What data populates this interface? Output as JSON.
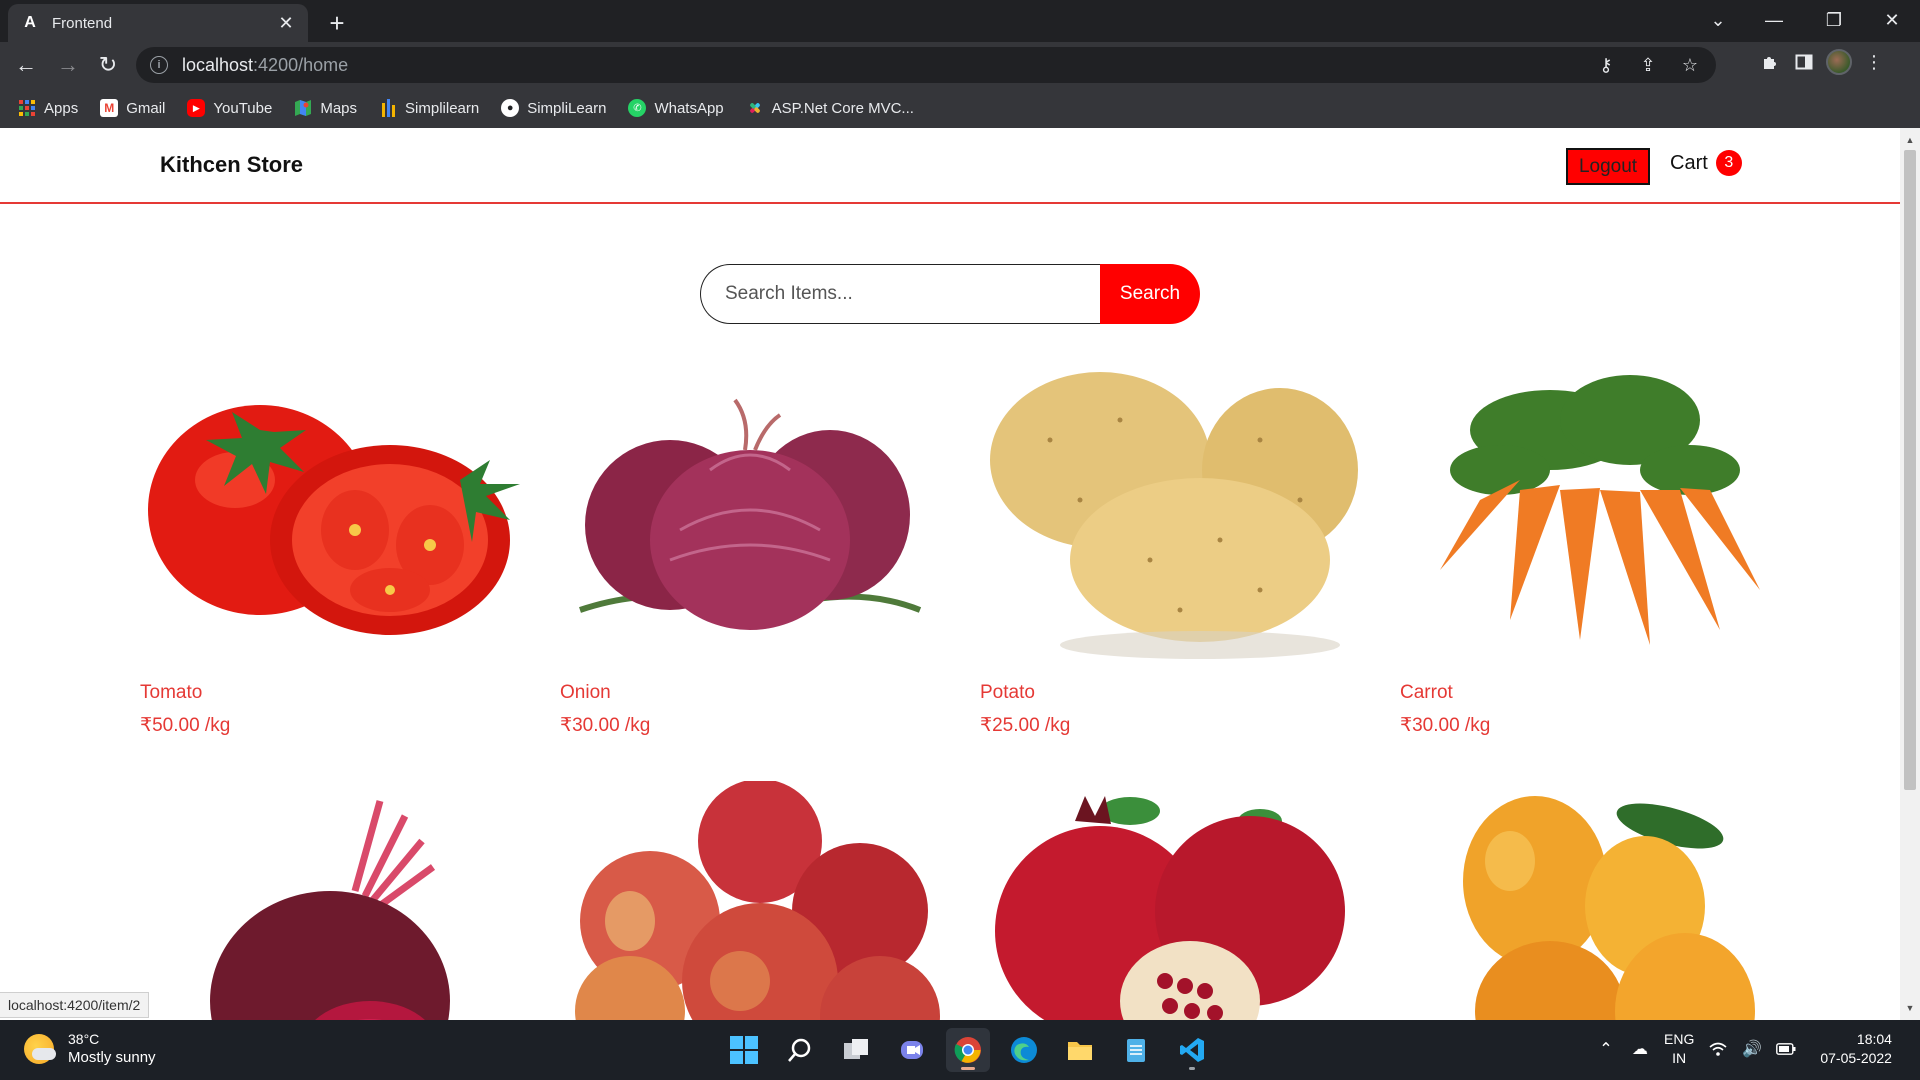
{
  "browser": {
    "tab_title": "Frontend",
    "tab_favicon": "A",
    "url_host": "localhost",
    "url_path": ":4200/home",
    "bookmarks": [
      {
        "label": "Apps",
        "icon": "apps-grid-icon",
        "color": "#4285f4"
      },
      {
        "label": "Gmail",
        "icon": "gmail-icon",
        "color": "#ea4335"
      },
      {
        "label": "YouTube",
        "icon": "youtube-icon",
        "color": "#ff0000"
      },
      {
        "label": "Maps",
        "icon": "maps-icon",
        "color": "#34a853"
      },
      {
        "label": "Simplilearn",
        "icon": "simplilearn-icon",
        "color": "#f4b400"
      },
      {
        "label": "SimpliLearn",
        "icon": "github-icon",
        "color": "#ffffff"
      },
      {
        "label": "WhatsApp",
        "icon": "whatsapp-icon",
        "color": "#25d366"
      },
      {
        "label": "ASP.Net Core MVC...",
        "icon": "slack-icon",
        "color": "#e01e5a"
      }
    ],
    "status_url": "localhost:4200/item/2"
  },
  "page": {
    "brand": "Kithcen Store",
    "logout_label": "Logout",
    "cart_label": "Cart",
    "cart_count": "3",
    "search_placeholder": "Search Items...",
    "search_button": "Search",
    "accent_color": "#ff0000",
    "products": [
      {
        "name": "Tomato",
        "price": "₹50.00 /kg",
        "image": "tomato"
      },
      {
        "name": "Onion",
        "price": "₹30.00 /kg",
        "image": "onion"
      },
      {
        "name": "Potato",
        "price": "₹25.00 /kg",
        "image": "potato"
      },
      {
        "name": "Carrot",
        "price": "₹30.00 /kg",
        "image": "carrot"
      },
      {
        "name": "",
        "price": "",
        "image": "beetroot"
      },
      {
        "name": "",
        "price": "",
        "image": "apple"
      },
      {
        "name": "",
        "price": "",
        "image": "pomegranate"
      },
      {
        "name": "",
        "price": "",
        "image": "mango"
      }
    ]
  },
  "taskbar": {
    "temperature": "38°C",
    "weather": "Mostly sunny",
    "lang_top": "ENG",
    "lang_bottom": "IN",
    "time": "18:04",
    "date": "07-05-2022"
  }
}
